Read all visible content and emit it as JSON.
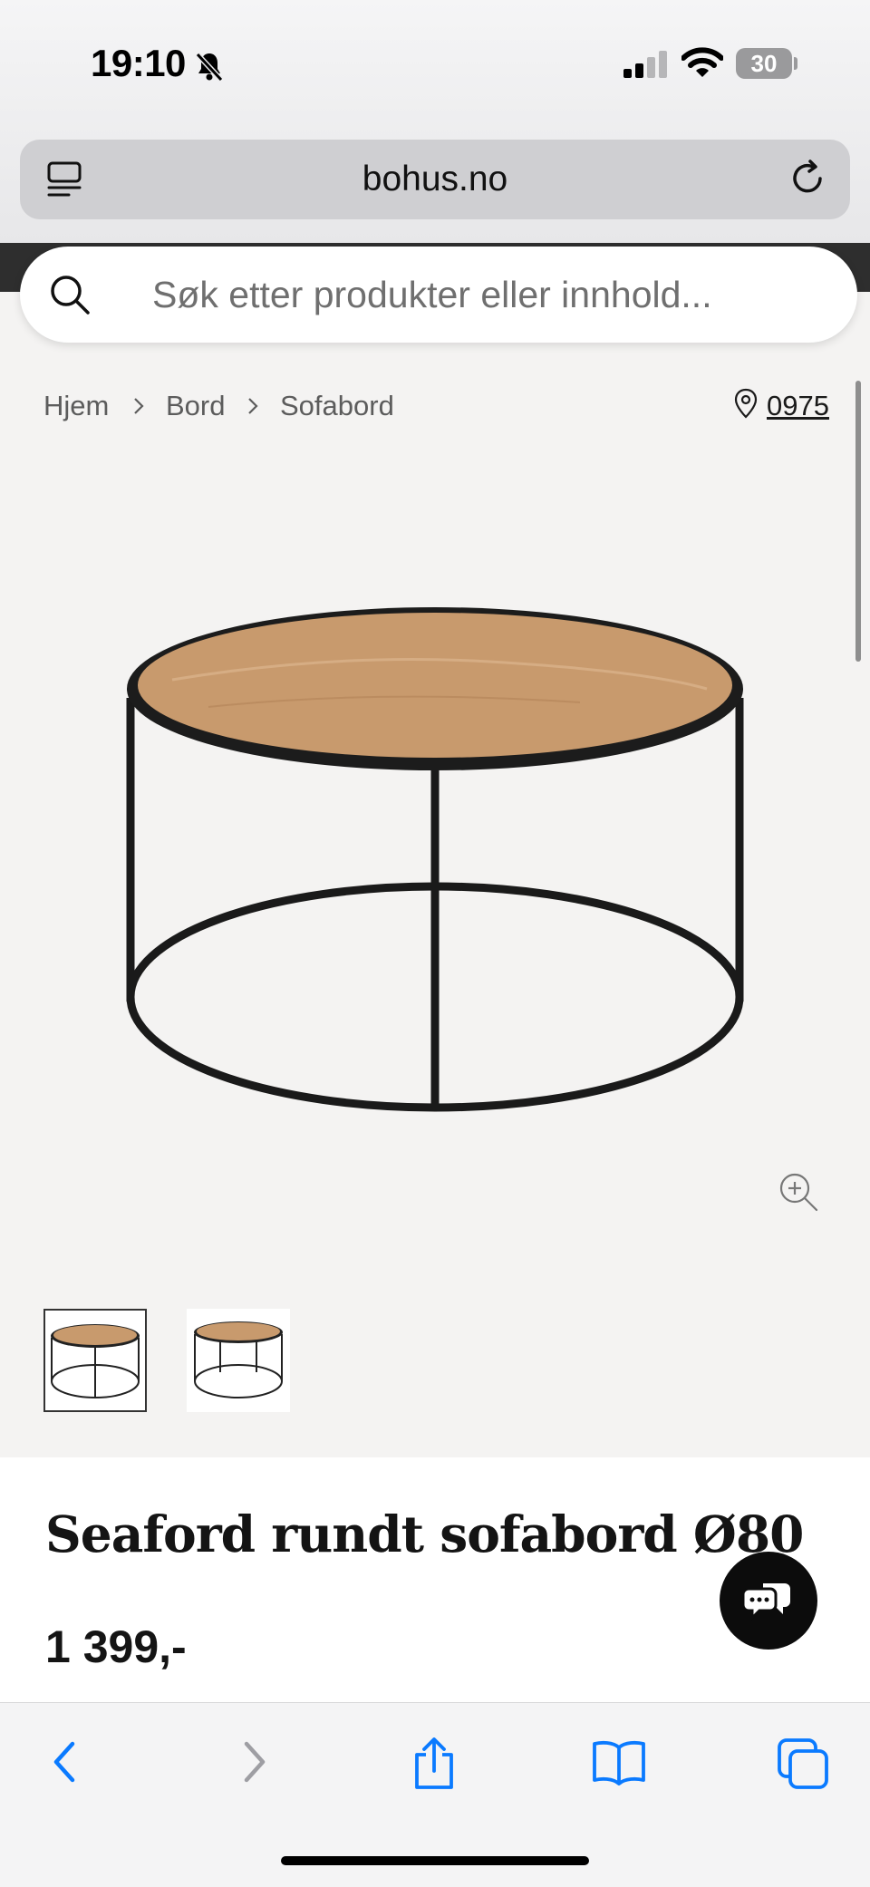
{
  "status": {
    "time": "19:10",
    "battery": "30"
  },
  "browser": {
    "url": "bohus.no"
  },
  "search": {
    "placeholder": "Søk etter produkter eller innhold..."
  },
  "breadcrumb": {
    "items": [
      "Hjem",
      "Bord",
      "Sofabord"
    ]
  },
  "store": {
    "code": "0975"
  },
  "product": {
    "title": "Seaford rundt sofabord Ø80",
    "price": "1 399,-",
    "thumbnail_count": 2,
    "selected_thumbnail": 1
  },
  "colors": {
    "accent": "#0a7aff",
    "chat": "#0c0c0c",
    "page_bg": "#f4f3f2",
    "table_top": "#c89a6d"
  }
}
